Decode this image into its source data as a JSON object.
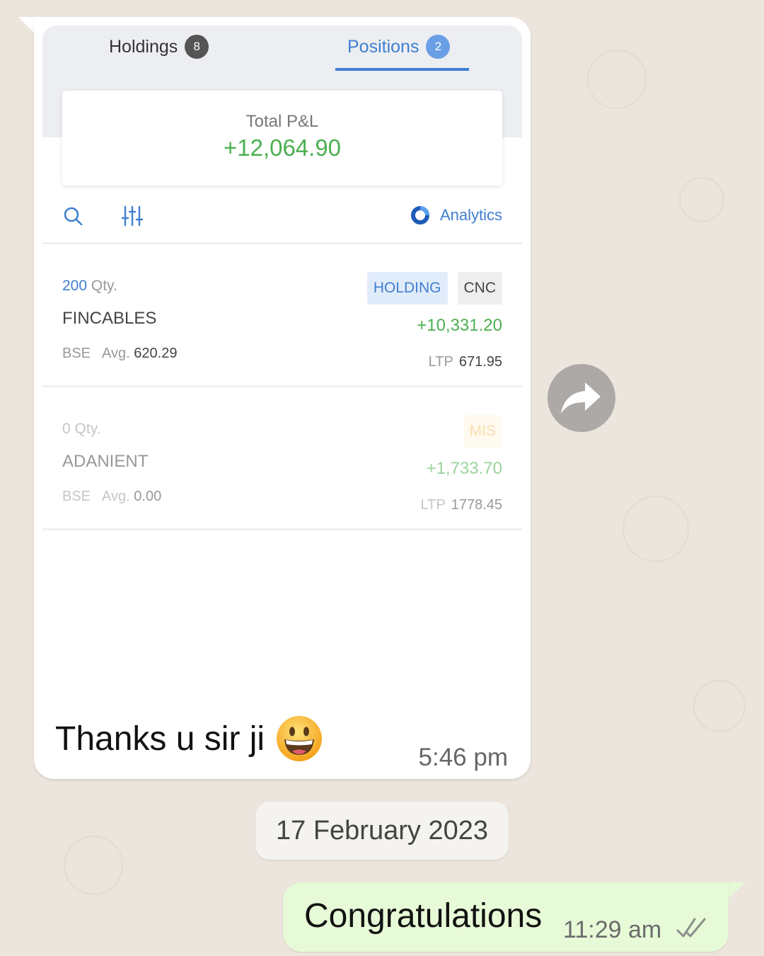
{
  "screenshot": {
    "tabs": [
      {
        "label": "Holdings",
        "count": "8"
      },
      {
        "label": "Positions",
        "count": "2"
      }
    ],
    "total_pnl": {
      "label": "Total P&L",
      "value": "+12,064.90"
    },
    "toolbar": {
      "analytics_label": "Analytics"
    },
    "positions": [
      {
        "qty": "200",
        "qty_unit": "Qty.",
        "name": "FINCABLES",
        "exchange": "BSE",
        "avg_label": "Avg.",
        "avg_value": "620.29",
        "tags": [
          "HOLDING",
          "CNC"
        ],
        "pnl": "+10,331.20",
        "ltp_label": "LTP",
        "ltp_value": "671.95"
      },
      {
        "qty": "0",
        "qty_unit": "Qty.",
        "name": "ADANIENT",
        "exchange": "BSE",
        "avg_label": "Avg.",
        "avg_value": "0.00",
        "tags": [
          "MIS"
        ],
        "pnl": "+1,733.70",
        "ltp_label": "LTP",
        "ltp_value": "1778.45"
      }
    ]
  },
  "incoming_message": {
    "text": "Thanks u sir ji",
    "emoji": "grinning-face-emoji",
    "time": "5:46 pm"
  },
  "date_separator": "17 February 2023",
  "outgoing_message": {
    "text": "Congratulations",
    "time": "11:29 am",
    "status": "read-double-tick"
  },
  "colors": {
    "chat_background": "#ece5dd",
    "outgoing_bubble": "#e7fad7",
    "accent_blue": "#3f7fd1",
    "profit_green": "#4caf50"
  }
}
